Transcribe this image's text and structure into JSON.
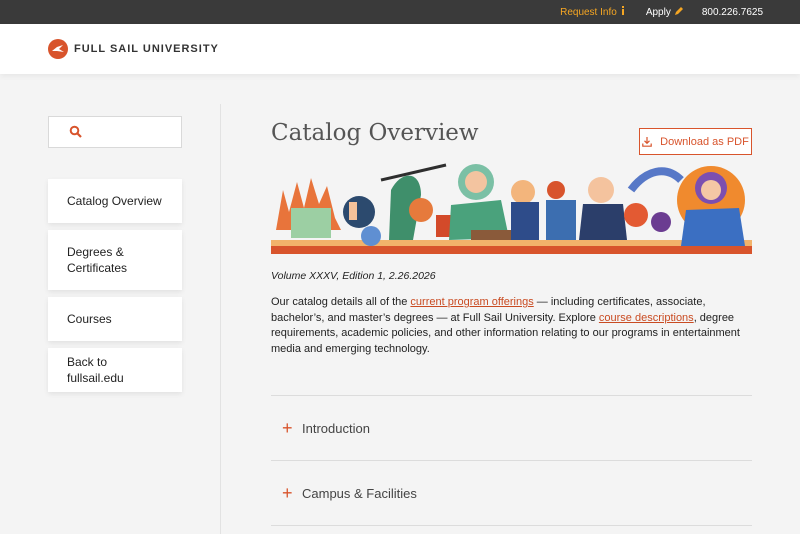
{
  "topbar": {
    "request_info": "Request Info",
    "apply": "Apply",
    "phone": "800.226.7625"
  },
  "header": {
    "logo_text": "FULL SAIL UNIVERSITY"
  },
  "search": {
    "placeholder": ""
  },
  "sidebar": {
    "items": [
      {
        "label": "Catalog Overview"
      },
      {
        "label": "Degrees & Certificates"
      },
      {
        "label": "Courses"
      },
      {
        "label": "Back to fullsail.edu"
      }
    ]
  },
  "main": {
    "title": "Catalog Overview",
    "download_label": "Download as PDF",
    "volume": "Volume XXXV, Edition 1, 2.26.2026",
    "intro": {
      "t1": "Our catalog details all of the ",
      "link1": "current program offerings",
      "t2": " — including certificates, associate, bachelor’s, and master’s degrees — at Full Sail University. Explore ",
      "link2": "course descriptions",
      "t3": ", degree requirements, academic policies, and other information relating to our programs in entertainment media and emerging technology."
    },
    "accordion": [
      {
        "label": "Introduction"
      },
      {
        "label": "Campus & Facilities"
      }
    ]
  },
  "colors": {
    "accent": "#d8542c",
    "topbar_bg": "#3a3a3a",
    "request_info": "#f5a623"
  }
}
